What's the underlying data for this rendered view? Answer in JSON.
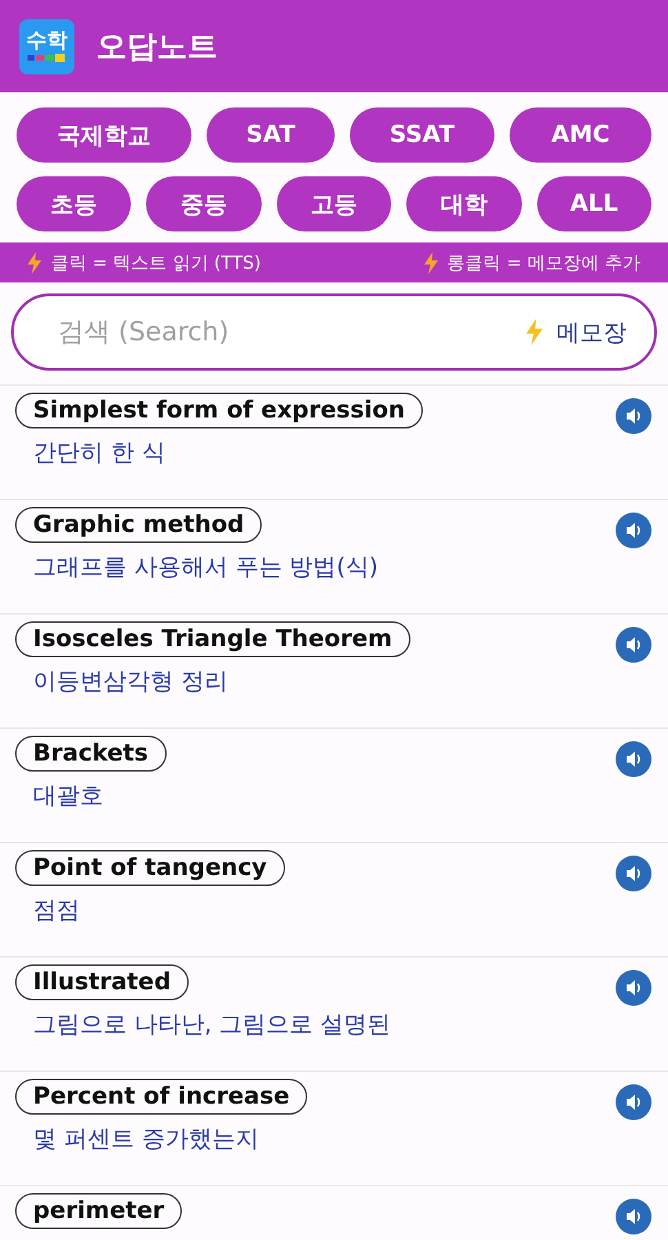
{
  "app_bar": {
    "icon_text": "수학",
    "title": "오답노트"
  },
  "filters": [
    [
      "국제학교",
      "SAT",
      "SSAT",
      "AMC"
    ],
    [
      "초등",
      "중등",
      "고등",
      "대학",
      "ALL"
    ]
  ],
  "hints": [
    "클릭 = 텍스트 읽기 (TTS)",
    "롱클릭 = 메모장에 추가"
  ],
  "search": {
    "placeholder": "검색 (Search)",
    "memo_button": "메모장"
  },
  "words": [
    {
      "term": "Simplest form of expression",
      "meaning": "간단히 한 식"
    },
    {
      "term": "Graphic method",
      "meaning": "그래프를 사용해서 푸는 방법(식)"
    },
    {
      "term": "Isosceles Triangle Theorem",
      "meaning": "이등변삼각형 정리"
    },
    {
      "term": "Brackets",
      "meaning": "대괄호"
    },
    {
      "term": "Point of tangency",
      "meaning": "점점"
    },
    {
      "term": "Illustrated",
      "meaning": "그림으로 나타난, 그림으로 설명된"
    },
    {
      "term": "Percent of increase",
      "meaning": "몇 퍼센트 증가했는지"
    },
    {
      "term": "perimeter"
    }
  ]
}
